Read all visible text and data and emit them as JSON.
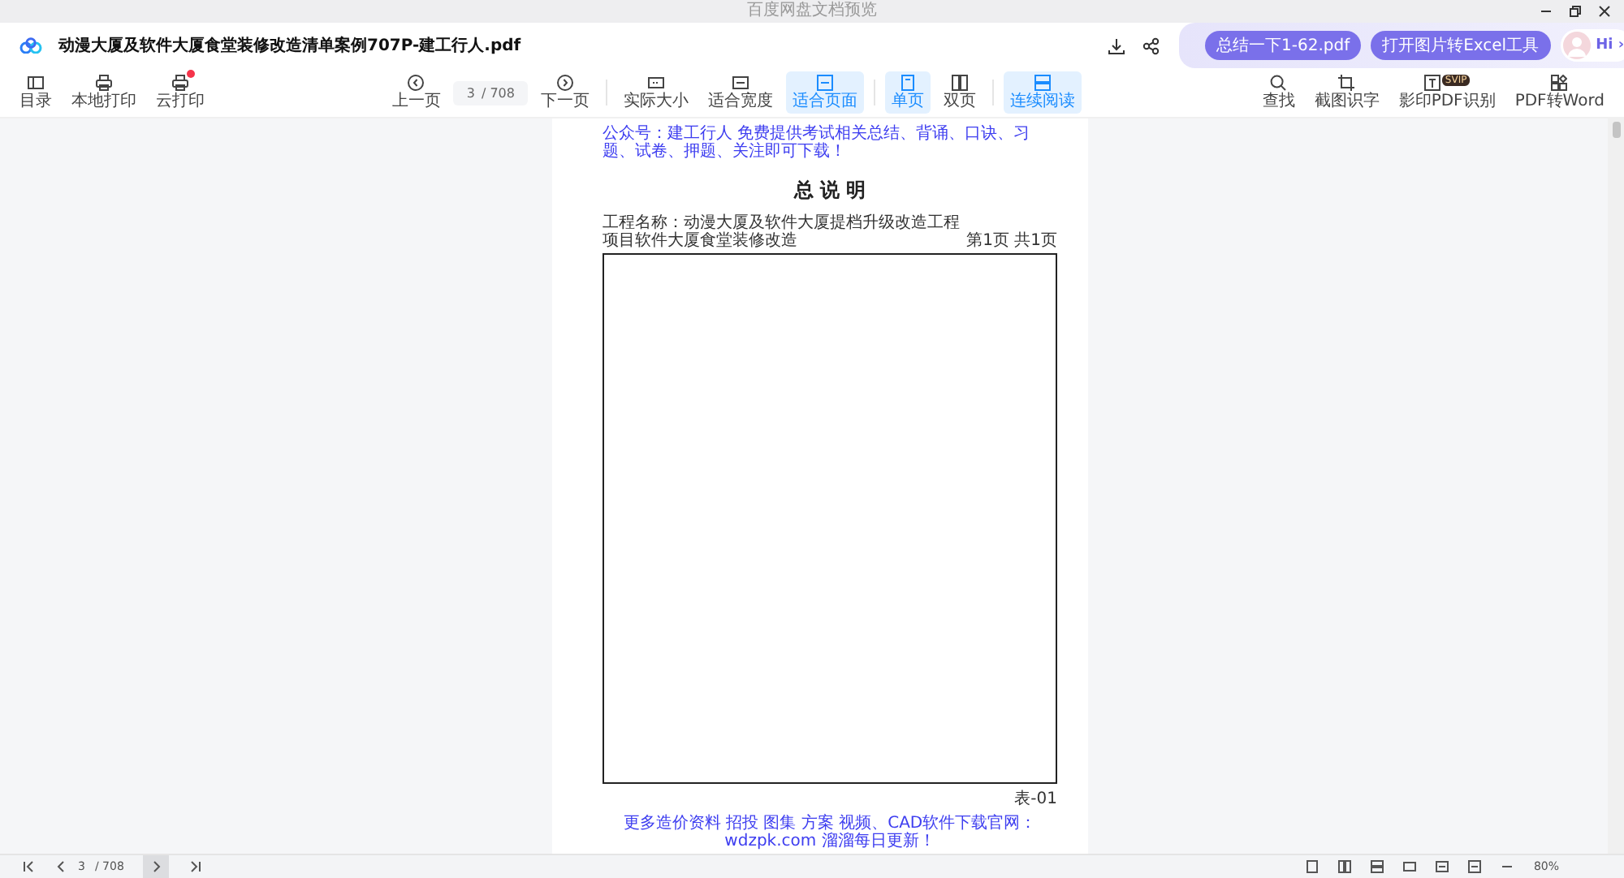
{
  "window": {
    "title": "百度网盘文档预览"
  },
  "header": {
    "file_name": "动漫大厦及软件大厦食堂装修改造清单案例707P-建工行人.pdf",
    "promo_buttons": [
      "总结一下1-62.pdf",
      "打开图片转Excel工具"
    ],
    "assistant_label": "Hi ›"
  },
  "toolbar": {
    "left": [
      {
        "label": "目录",
        "notification": false
      },
      {
        "label": "本地打印",
        "notification": false
      },
      {
        "label": "云打印",
        "notification": true
      }
    ],
    "prev_label": "上一页",
    "page_input": {
      "value": "3",
      "total": "/ 708"
    },
    "next_label": "下一页",
    "view_options": [
      {
        "label": "实际大小",
        "selected": false
      },
      {
        "label": "适合宽度",
        "selected": false
      },
      {
        "label": "适合页面",
        "selected": true
      },
      {
        "label": "单页",
        "selected": true
      },
      {
        "label": "双页",
        "selected": false
      },
      {
        "label": "连续阅读",
        "selected": true
      }
    ],
    "right": [
      {
        "label": "查找"
      },
      {
        "label": "截图识字"
      },
      {
        "label": "影印PDF识别",
        "badge": "SVIP"
      },
      {
        "label": "PDF转Word"
      }
    ]
  },
  "document": {
    "notice": "公众号：建工行人 免费提供考试相关总结、背诵、口诀、习题、试卷、押题、关注即可下载！",
    "title": "总 说 明",
    "project_line": "工程名称：动漫大厦及软件大厦提档升级改造工程项目软件大厦食堂装修改造",
    "page_info": "第1页 共1页",
    "table_number": "表-01",
    "footer_notice": "更多造价资料 招投 图集 方案 视频、CAD软件下载官网：wdzpk.com 溜溜每日更新！"
  },
  "status_bar": {
    "page": "3",
    "total": "/ 708",
    "zoom": "80%"
  }
}
